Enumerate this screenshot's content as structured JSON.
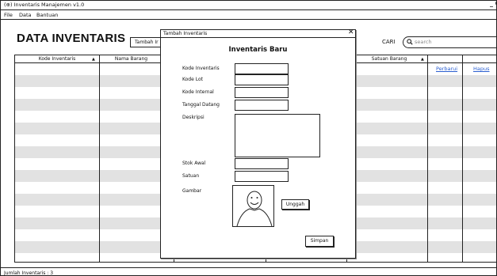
{
  "window": {
    "title": "(⊕) Inventaris Manajemen v1.0",
    "controls": "_ O"
  },
  "menu": {
    "items": [
      "File",
      "Data",
      "Bantuan"
    ]
  },
  "page": {
    "title": "DATA INVENTARIS",
    "add_button": "Tambah Ir"
  },
  "search": {
    "label": "CARI",
    "placeholder": "search",
    "icon": "search-icon"
  },
  "table": {
    "columns": [
      "Kode Inventaris",
      "Nama Barang",
      "Satuan Barang"
    ],
    "sort_indicator": "▲",
    "actions": {
      "edit": "Perbarui",
      "delete": "Hapus"
    },
    "row_count": 17
  },
  "status": {
    "text": "Jumlah Inventaris : 3"
  },
  "dialog": {
    "window_title": "Tambah Inventaris",
    "heading": "Inventaris Baru",
    "fields": {
      "kode_inventaris": "Kode Inventaris",
      "kode_lot": "Kode Lot",
      "kode_internal": "Kode Internal",
      "tanggal_datang": "Tanggal Datang",
      "deskripsi": "Deskripsi",
      "stok_awal": "Stok Awal",
      "satuan": "Satuan",
      "gambar": "Gambar"
    },
    "upload_button": "Unggah",
    "save_button": "Simpan",
    "close_icon": "close-icon"
  },
  "colors": {
    "link": "#2b5fd0",
    "row_alt": "#e2e2e2",
    "border": "#222222"
  }
}
